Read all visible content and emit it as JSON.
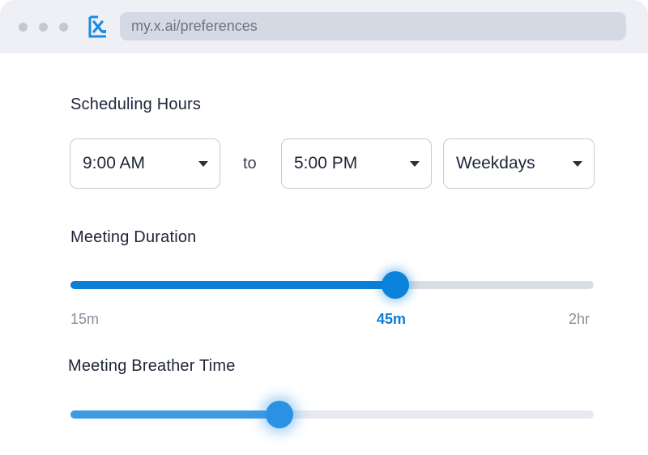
{
  "browser": {
    "url": "my.x.ai/preferences",
    "logo_icon": "x-ai-logo-icon"
  },
  "scheduling": {
    "title": "Scheduling Hours",
    "start_time": "9:00 AM",
    "separator": "to",
    "end_time": "5:00 PM",
    "days": "Weekdays"
  },
  "duration": {
    "title": "Meeting Duration",
    "min_label": "15m",
    "value_label": "45m",
    "max_label": "2hr",
    "value_fraction": 0.62
  },
  "breather": {
    "title": "Meeting Breather Time",
    "value_fraction": 0.4
  },
  "colors": {
    "accent": "#0b7fd6",
    "track": "#d9dde6"
  }
}
